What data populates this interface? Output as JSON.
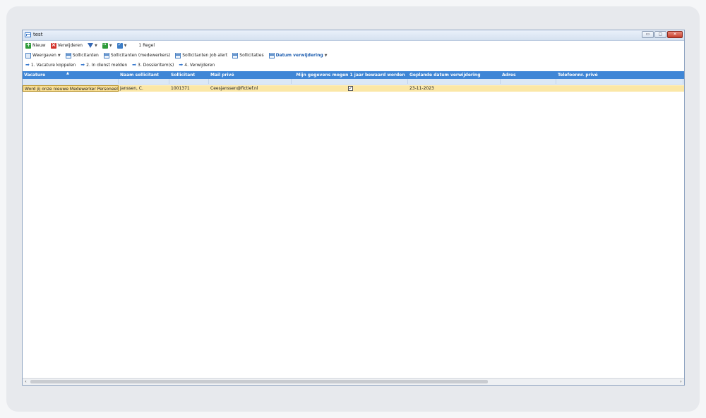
{
  "window": {
    "title": "test",
    "controls": {
      "minimize": "▭",
      "restore": "▢",
      "close": "✕"
    }
  },
  "toolbar1": {
    "new_label": "Nieuw",
    "delete_label": "Verwijderen",
    "record_count": "1 Regel"
  },
  "toolbar2": {
    "views_label": "Weergaven",
    "items": [
      "Sollicitanten",
      "Sollicitanten (medewerkers)",
      "Sollicitanten Job alert",
      "Sollicitaties"
    ],
    "active_label": "Datum verwijdering"
  },
  "toolbar3": {
    "steps": [
      "1. Vacature koppelen",
      "2. In dienst melden",
      "3. Dossieritem(s)",
      "4. Verwijderen"
    ]
  },
  "grid": {
    "columns": [
      "Vacature",
      "Naam sollicitant",
      "Sollicitant",
      "Mail privé",
      "Mijn gegevens mogen 1 jaar bewaard worden",
      "Geplande datum verwijdering",
      "Adres",
      "Telefoonnr. privé"
    ],
    "rows": [
      {
        "vacature": "Word jij onze nieuwe Medewerker Personeels",
        "naam": "Janssen, C.",
        "sollicitant": "1001371",
        "mail": "Ceesjanssen@fictief.nl",
        "bewaren_checked": true,
        "datum": "23-11-2023",
        "adres": "",
        "telefoon": ""
      }
    ]
  },
  "colors": {
    "header_bg": "#3f86d6",
    "selected_row": "#fbe7a6",
    "accent": "#1f5fb0"
  }
}
